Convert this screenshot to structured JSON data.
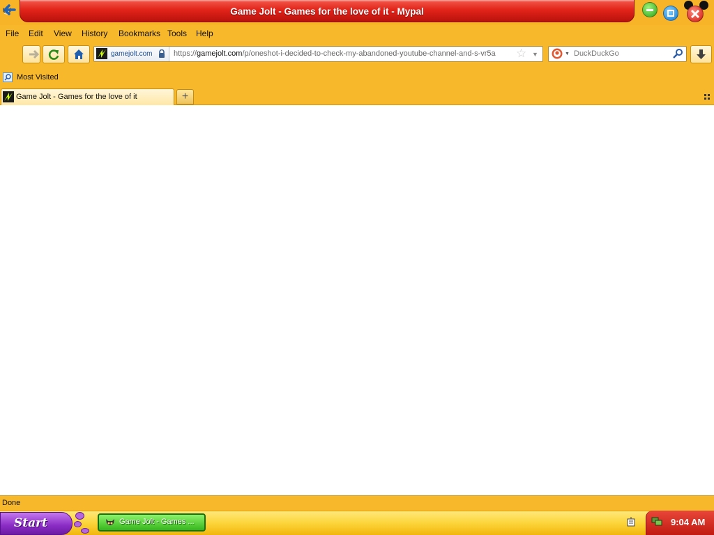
{
  "window": {
    "title": "Game Jolt - Games for the love of it - Mypal"
  },
  "menu": {
    "file": "File",
    "edit": "Edit",
    "view": "View",
    "history": "History",
    "bookmarks": "Bookmarks",
    "tools": "Tools",
    "help": "Help"
  },
  "navigation": {
    "site_identity": "gamejolt.com",
    "url_scheme": "https://",
    "url_host": "gamejolt.com",
    "url_path": "/p/oneshot-i-decided-to-check-my-abandoned-youtube-channel-and-s-vr5a",
    "search_engine": "DuckDuckGo",
    "icons": [
      "back-arrow-icon",
      "forward-arrow-icon",
      "reload-icon",
      "home-icon",
      "lock-icon",
      "star-icon",
      "search-icon",
      "download-icon"
    ]
  },
  "bookmarks_bar": {
    "items": [
      {
        "label": "Most Visited"
      }
    ]
  },
  "tabs": [
    {
      "label": "Game Jolt - Games for the love of it",
      "active": true
    }
  ],
  "newtab": {
    "label": "+"
  },
  "status": {
    "text": "Done"
  },
  "taskbar": {
    "start_label": "Start",
    "task_label": "Game Jolt - Games ...",
    "clock": "9:04 AM"
  },
  "colors": {
    "chrome": "#f7b82c",
    "title_red": "#e2241a",
    "start_purple": "#8a2cc4",
    "task_green": "#36b61c"
  }
}
